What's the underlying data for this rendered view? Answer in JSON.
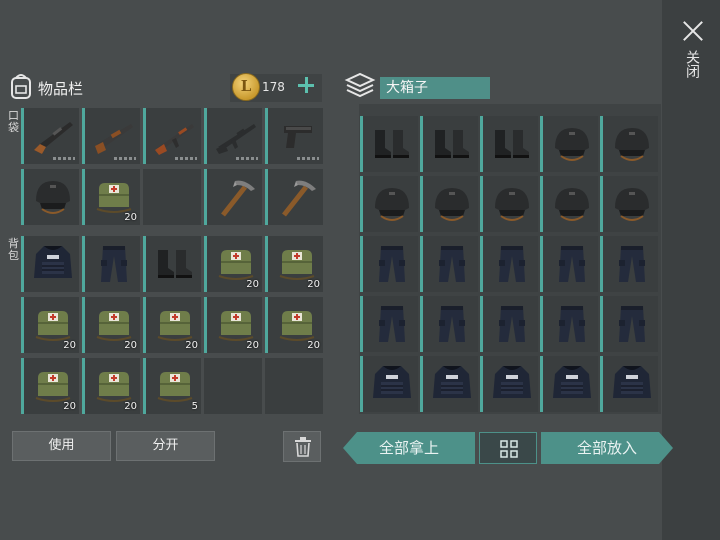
{
  "inventory": {
    "title": "物品栏",
    "coins": "178",
    "coin_symbol": "L",
    "pocket_label": "口袋",
    "backpack_label": "背包",
    "pocket_row1": [
      {
        "icon": "rifle-icon",
        "type": "rifle",
        "count": "",
        "durability": true
      },
      {
        "icon": "shotgun-icon",
        "type": "shotgun",
        "count": "",
        "durability": true
      },
      {
        "icon": "assault-rifle-icon",
        "type": "ak",
        "count": "",
        "durability": true
      },
      {
        "icon": "m16-rifle-icon",
        "type": "m16",
        "count": "",
        "durability": true
      },
      {
        "icon": "pistol-icon",
        "type": "pistol",
        "count": "",
        "durability": true
      }
    ],
    "pocket_row2": [
      {
        "icon": "helmet-icon",
        "type": "helmet",
        "count": ""
      },
      {
        "icon": "medkit-icon",
        "type": "medkit",
        "count": "20"
      },
      {
        "icon": "",
        "type": "empty",
        "count": ""
      },
      {
        "icon": "pickaxe-icon",
        "type": "pickaxe",
        "count": ""
      },
      {
        "icon": "pickaxe-icon",
        "type": "pickaxe",
        "count": ""
      }
    ],
    "backpack": [
      {
        "icon": "armor-vest-icon",
        "type": "vest",
        "count": ""
      },
      {
        "icon": "pants-icon",
        "type": "pants",
        "count": ""
      },
      {
        "icon": "boots-icon",
        "type": "boots",
        "count": ""
      },
      {
        "icon": "medkit-icon",
        "type": "medkit",
        "count": "20"
      },
      {
        "icon": "medkit-icon",
        "type": "medkit",
        "count": "20"
      },
      {
        "icon": "medkit-icon",
        "type": "medkit",
        "count": "20"
      },
      {
        "icon": "medkit-icon",
        "type": "medkit",
        "count": "20"
      },
      {
        "icon": "medkit-icon",
        "type": "medkit",
        "count": "20"
      },
      {
        "icon": "medkit-icon",
        "type": "medkit",
        "count": "20"
      },
      {
        "icon": "medkit-icon",
        "type": "medkit",
        "count": "20"
      },
      {
        "icon": "medkit-icon",
        "type": "medkit",
        "count": "20"
      },
      {
        "icon": "medkit-icon",
        "type": "medkit",
        "count": "20"
      },
      {
        "icon": "medkit-icon",
        "type": "medkit",
        "count": "5"
      },
      {
        "icon": "",
        "type": "empty",
        "count": ""
      },
      {
        "icon": "",
        "type": "empty",
        "count": ""
      }
    ],
    "use_label": "使用",
    "split_label": "分开"
  },
  "chest": {
    "title": "大箱子",
    "rows": [
      [
        "boots",
        "boots",
        "boots",
        "helmet",
        "helmet"
      ],
      [
        "helmet",
        "helmet",
        "helmet",
        "helmet",
        "helmet"
      ],
      [
        "pants",
        "pants",
        "pants",
        "pants",
        "pants"
      ],
      [
        "pants",
        "pants",
        "pants",
        "pants",
        "pants"
      ],
      [
        "vest",
        "vest",
        "vest",
        "vest",
        "vest"
      ]
    ],
    "take_all_label": "全部拿上",
    "put_all_label": "全部放入"
  },
  "close_label": "关闭",
  "colors": {
    "accent": "#4fa89d",
    "button_teal": "#4d9189",
    "slot": "#3a3e3f",
    "coin": "#e0b445"
  }
}
